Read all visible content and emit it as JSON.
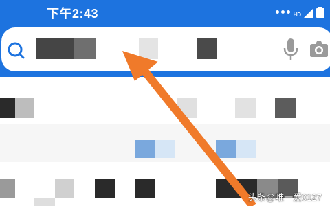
{
  "status_bar": {
    "time": "下午2:43",
    "network_badge": "HD",
    "icons": [
      "signal-icon",
      "battery-icon"
    ]
  },
  "search": {
    "icons": [
      "search-icon",
      "microphone-icon",
      "camera-icon"
    ]
  },
  "colors": {
    "header_blue": "#1d73df",
    "arrow_orange": "#f07a2a",
    "tile_dark": "#2a2a2a",
    "tile_gray": "#bdbdbd",
    "tile_blue": "#7aa8dd"
  },
  "watermark": {
    "text": "头条@唯一爱0127"
  }
}
